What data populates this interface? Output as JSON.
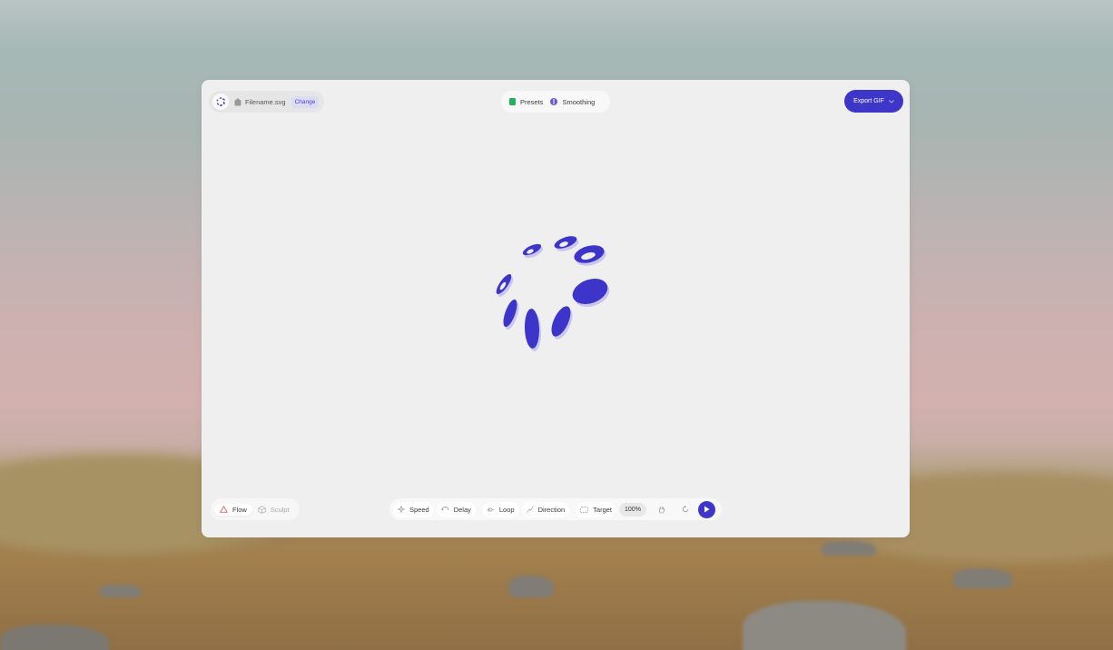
{
  "file": {
    "name": "Filename.svg",
    "change_label": "Change"
  },
  "top_menu": {
    "presets_label": "Presets",
    "smoothing_label": "Smoothing"
  },
  "export": {
    "label": "Export GIF"
  },
  "modes": {
    "flow_label": "Flow",
    "sculpt_label": "Sculpt",
    "active": "Flow"
  },
  "controls": {
    "speed_label": "Speed",
    "delay_label": "Delay",
    "loop_label": "Loop",
    "direction_label": "Direction",
    "target_label": "Target",
    "zoom": "100%"
  },
  "colors": {
    "accent": "#3e36c9",
    "presets_icon": "#22b35a",
    "smoothing_icon": "#6b5bd6",
    "flow_icon": "#e05a5a"
  },
  "icons": [
    "app-logo-icon",
    "file-icon",
    "presets-icon",
    "smoothing-icon",
    "chevron-down-icon",
    "flow-icon",
    "sculpt-icon",
    "speed-icon",
    "delay-icon",
    "loop-icon",
    "direction-icon",
    "target-icon",
    "hand-icon",
    "reset-icon",
    "play-icon"
  ]
}
